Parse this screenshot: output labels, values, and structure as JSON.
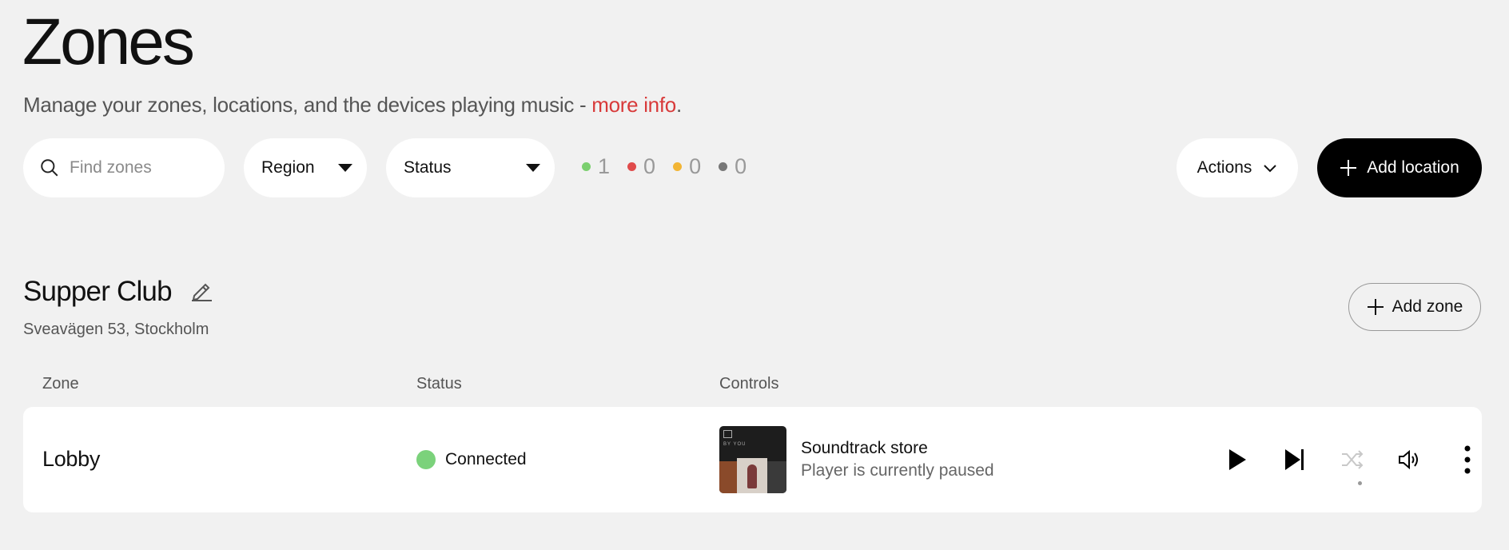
{
  "page": {
    "title": "Zones",
    "subtitle_text": "Manage your zones, locations, and the devices playing music - ",
    "subtitle_link": "more info",
    "subtitle_end": "."
  },
  "toolbar": {
    "search_placeholder": "Find zones",
    "region_label": "Region",
    "status_label": "Status",
    "counts": [
      {
        "value": "1",
        "color": "#7bcf6f"
      },
      {
        "value": "0",
        "color": "#e04b4b"
      },
      {
        "value": "0",
        "color": "#f2b535"
      },
      {
        "value": "0",
        "color": "#777777"
      }
    ],
    "actions_label": "Actions",
    "add_location_label": "Add location"
  },
  "location": {
    "name": "Supper Club",
    "address": "Sveavägen 53, Stockholm",
    "add_zone_label": "Add zone"
  },
  "table": {
    "headers": {
      "zone": "Zone",
      "status": "Status",
      "controls": "Controls"
    },
    "rows": [
      {
        "zone": "Lobby",
        "status": "Connected",
        "status_color": "#7bd27b",
        "cover_tag": "BY YOU",
        "track_name": "Soundtrack store",
        "track_state": "Player is currently paused"
      }
    ]
  },
  "icons": [
    "search-icon",
    "chevron-down-icon",
    "plus-icon",
    "pencil-icon",
    "play-icon",
    "skip-next-icon",
    "shuffle-icon",
    "volume-icon",
    "more-vertical-icon"
  ]
}
